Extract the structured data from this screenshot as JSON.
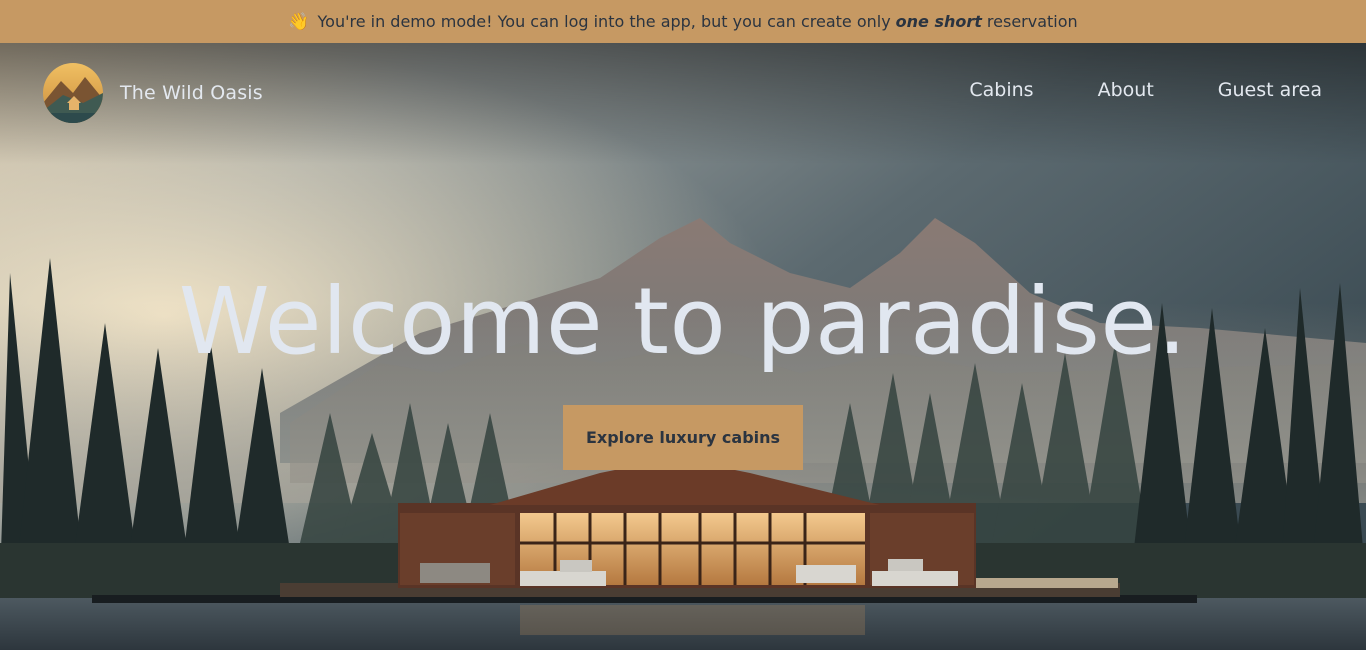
{
  "banner": {
    "wave_emoji": "👋",
    "text_before": "You're in demo mode! You can log into the app, but you can create only",
    "emphasis": "one short",
    "text_after": "reservation"
  },
  "header": {
    "brand": "The Wild Oasis",
    "nav": [
      "Cabins",
      "About",
      "Guest area"
    ]
  },
  "hero": {
    "title": "Welcome to paradise.",
    "cta": "Explore luxury cabins"
  },
  "colors": {
    "accent": "#c69963",
    "dark_text": "#2b3440",
    "light_text": "#e3e8ef"
  }
}
